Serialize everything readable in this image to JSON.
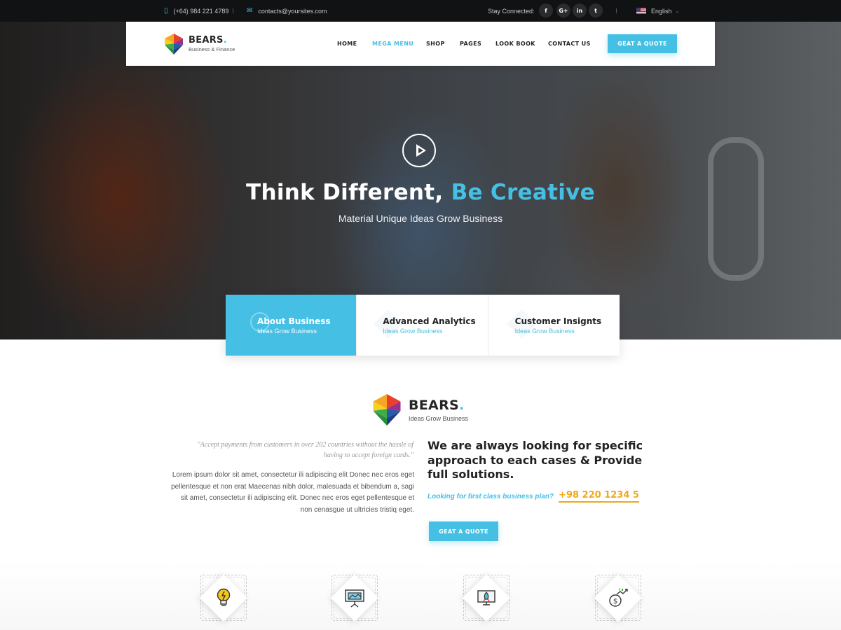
{
  "topbar": {
    "phone": "(+64) 984 221 4789",
    "email": "contacts@yoursites.com",
    "stay_connected": "Stay Connected:",
    "social": [
      {
        "name": "facebook",
        "label": "f"
      },
      {
        "name": "google-plus",
        "label": "G+"
      },
      {
        "name": "linkedin",
        "label": "in"
      },
      {
        "name": "twitter",
        "label": "t"
      }
    ],
    "language": "English"
  },
  "nav": {
    "logo_name": "BEARS",
    "logo_dot": ".",
    "logo_tagline": "Business & Finance",
    "items": [
      "HOME",
      "MEGA MENU",
      "SHOP",
      "PAGES",
      "LOOK BOOK",
      "CONTACT US"
    ],
    "active_item": "MEGA MENU",
    "quote_button": "GEAT A QUOTE"
  },
  "hero": {
    "title_plain": "Think Different,",
    "title_accent": "Be Creative",
    "subtitle": "Material Unique Ideas Grow Business"
  },
  "features": [
    {
      "title": "About Business",
      "subtitle": "Ideas Grow Business",
      "active": true
    },
    {
      "title": "Advanced Analytics",
      "subtitle": "Ideas Grow Business",
      "active": false
    },
    {
      "title": "Customer Insignts",
      "subtitle": "Ideas Grow Business",
      "active": false
    }
  ],
  "about": {
    "logo_name": "BEARS",
    "logo_dot": ".",
    "logo_tagline": "Ideas Grow Business",
    "quote": "\"Accept payments from customers in over 202 countries without the hassle of having to accept foreign cards.\"",
    "paragraph": "Lorem ipsum dolor sit amet, consectetur ili adipiscing  elit Donec nec eros eget pellentesque et non erat Maecenas nibh dolor, malesuada et bibendum a, sagi sit amet, consectetur ili adipiscing  elit. Donec nec eros eget pellentesque et non cenasgue ut ultricies tristiq eget.",
    "heading": "We are always looking for specific approach to each cases & Provide full solutions.",
    "question": "Looking for first class business plan?",
    "phone": "+98 220 1234 5",
    "quote_button": "GEAT A QUOTE"
  },
  "services": [
    {
      "icon": "lightbulb-icon"
    },
    {
      "icon": "presentation-board-icon"
    },
    {
      "icon": "rocket-launch-icon"
    },
    {
      "icon": "money-growth-icon"
    }
  ],
  "colors": {
    "accent": "#45c0e4",
    "topbar_bg": "#111214",
    "phone_highlight": "#f0a81c"
  }
}
